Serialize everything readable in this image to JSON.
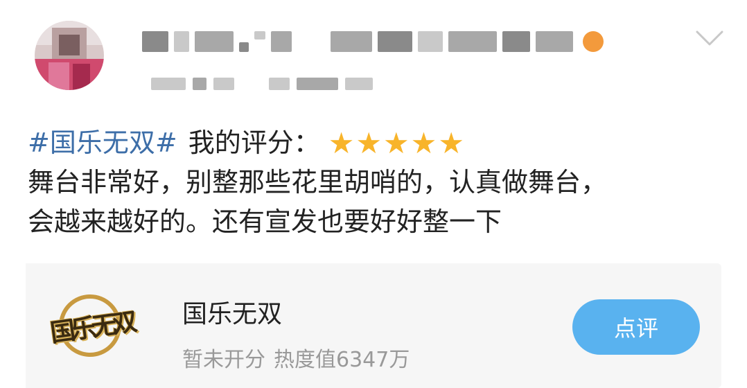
{
  "post": {
    "topic": "#国乐无双#",
    "rating_label": "我的评分：",
    "rating_stars": 5,
    "rating_max": 5,
    "body_lines": [
      "舞台非常好，别整那些花里胡哨的，认真做舞台，",
      "会越来越好的。还有宣发也要好好整一下"
    ]
  },
  "card": {
    "logo_text": "国乐无双",
    "title": "国乐无双",
    "score_status": "暂未开分",
    "heat": "热度值6347万",
    "action_label": "点评"
  },
  "icons": {
    "expand": "chevron-down-icon",
    "star": "star-icon",
    "vip": "vip-badge-icon"
  },
  "colors": {
    "topic_link": "#3d6ea8",
    "star": "#f8b42a",
    "button": "#59b2ef",
    "card_bg": "#f6f6f6"
  }
}
